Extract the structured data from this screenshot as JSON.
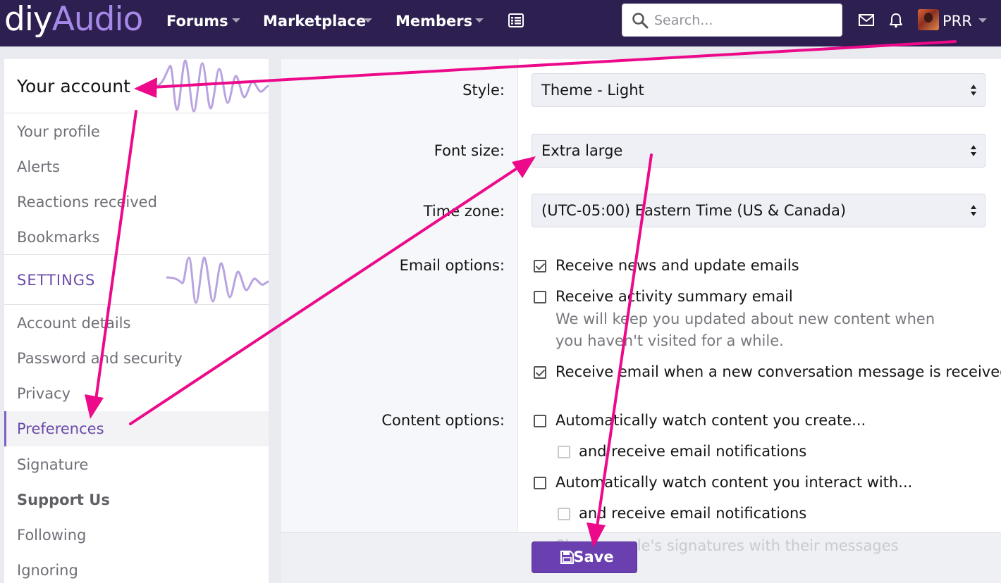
{
  "header": {
    "logo_part1": "diy",
    "logo_part2": "Audio",
    "nav": [
      {
        "label": "Forums"
      },
      {
        "label": "Marketplace"
      },
      {
        "label": "Members"
      }
    ],
    "search_placeholder": "Search...",
    "username": "PRR"
  },
  "sidebar": {
    "account_title": "Your account",
    "account_items": [
      "Your profile",
      "Alerts",
      "Reactions received",
      "Bookmarks"
    ],
    "settings_title": "SETTINGS",
    "settings_items": [
      "Account details",
      "Password and security",
      "Privacy",
      "Preferences",
      "Signature",
      "Support Us",
      "Following",
      "Ignoring"
    ],
    "active_item": "Preferences"
  },
  "form": {
    "style": {
      "label": "Style:",
      "value": "Theme - Light"
    },
    "font_size": {
      "label": "Font size:",
      "value": "Extra large"
    },
    "time_zone": {
      "label": "Time zone:",
      "value": "(UTC-05:00) Eastern Time (US & Canada)"
    },
    "email_options": {
      "label": "Email options:",
      "news": {
        "text": "Receive news and update emails",
        "checked": true
      },
      "activity": {
        "text": "Receive activity summary email",
        "checked": false
      },
      "activity_hint": "We will keep you updated about new content when you haven't visited for a while.",
      "conversation": {
        "text": "Receive email when a new conversation message is received",
        "checked": true
      }
    },
    "content_options": {
      "label": "Content options:",
      "watch_create": {
        "text": "Automatically watch content you create...",
        "checked": false
      },
      "watch_create_email": {
        "text": "and receive email notifications",
        "checked": false
      },
      "watch_interact": {
        "text": "Automatically watch content you interact with...",
        "checked": false
      },
      "watch_interact_email": {
        "text": "and receive email notifications",
        "checked": false
      }
    },
    "signatures_text": "Show people's signatures with their messages",
    "save_label": "Save"
  },
  "colors": {
    "topbar": "#2d1f4f",
    "accent": "#6a3fb0",
    "annotation": "#ec0a8a"
  }
}
